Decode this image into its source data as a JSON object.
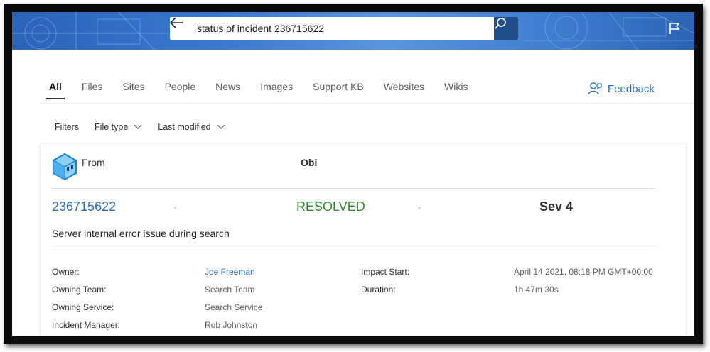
{
  "search": {
    "query": "status of incident 236715622"
  },
  "tabs": [
    {
      "label": "All",
      "active": true
    },
    {
      "label": "Files",
      "active": false
    },
    {
      "label": "Sites",
      "active": false
    },
    {
      "label": "People",
      "active": false
    },
    {
      "label": "News",
      "active": false
    },
    {
      "label": "Images",
      "active": false
    },
    {
      "label": "Support KB",
      "active": false
    },
    {
      "label": "Websites",
      "active": false
    },
    {
      "label": "Wikis",
      "active": false
    }
  ],
  "feedback_label": "Feedback",
  "filters": {
    "label": "Filters",
    "file_type": "File type",
    "last_modified": "Last modified"
  },
  "card": {
    "from_label": "From",
    "from_value": "Obi",
    "incident_id": "236715622",
    "separator": "-",
    "status": "RESOLVED",
    "severity": "Sev 4",
    "summary": "Server internal error issue during search",
    "left_fields": [
      {
        "key": "Owner:",
        "value": "Joe Freeman"
      },
      {
        "key": "Owning Team:",
        "value": "Search Team"
      },
      {
        "key": "Owning Service:",
        "value": "Search Service"
      },
      {
        "key": "Incident Manager:",
        "value": "Rob Johnston"
      }
    ],
    "right_fields": [
      {
        "key": "Impact Start:",
        "value": "April 14 2021, 08:18 PM GMT+00:00"
      },
      {
        "key": "Duration:",
        "value": "1h 47m 30s"
      }
    ]
  },
  "colors": {
    "accent": "#2b6cc4",
    "resolved": "#2e8b2e",
    "banner": "#3a78d0"
  }
}
